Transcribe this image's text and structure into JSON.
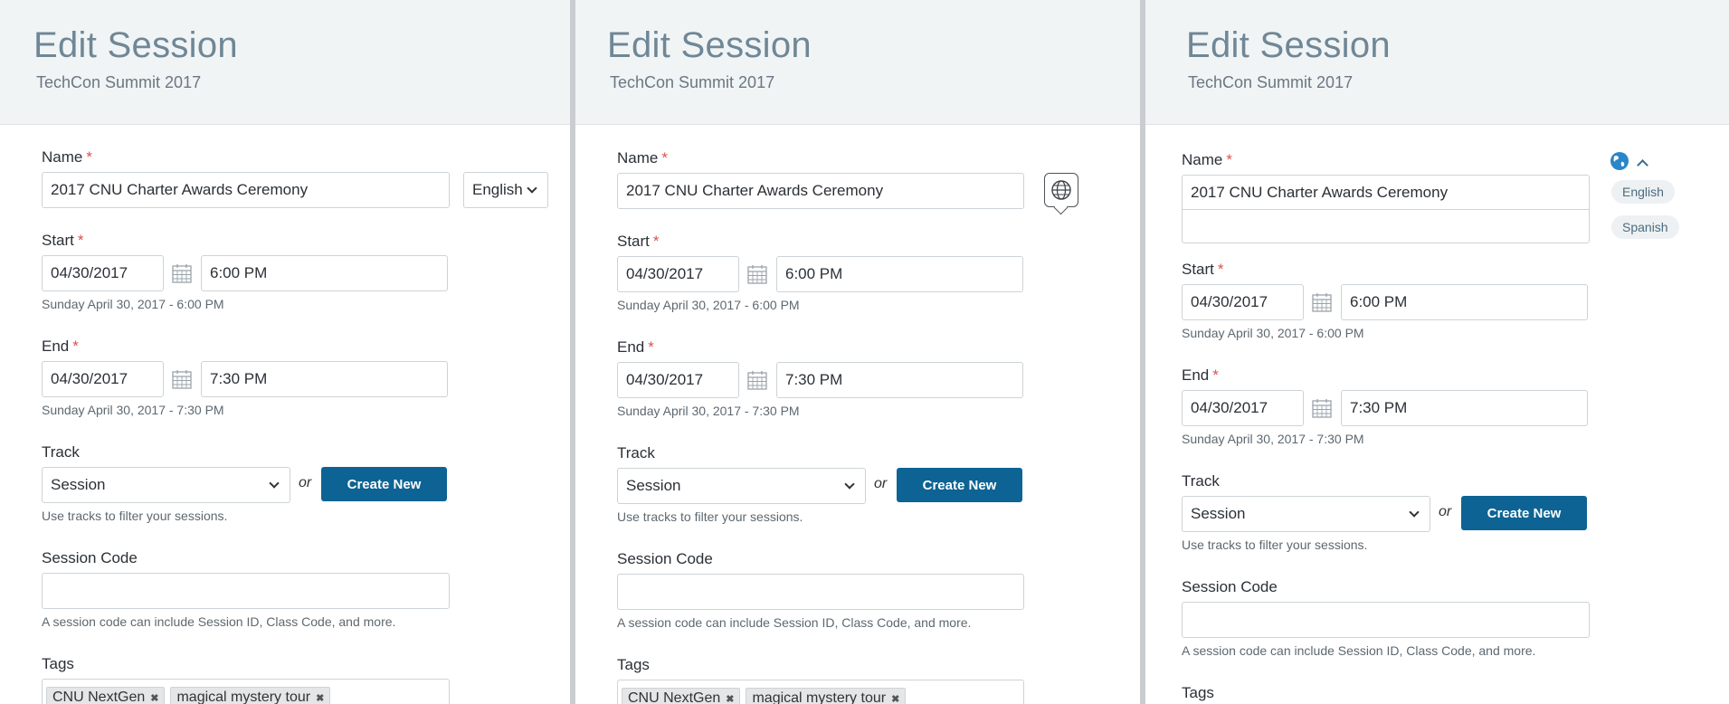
{
  "header": {
    "title": "Edit Session",
    "subtitle": "TechCon Summit 2017"
  },
  "form": {
    "name_label": "Name",
    "required_mark": "*",
    "name_value": "2017 CNU Charter Awards Ceremony",
    "start_label": "Start",
    "start_date": "04/30/2017",
    "start_time": "6:00 PM",
    "start_summary": "Sunday April 30, 2017 - 6:00 PM",
    "end_label": "End",
    "end_date": "04/30/2017",
    "end_time": "7:30 PM",
    "end_summary": "Sunday April 30, 2017 - 7:30 PM",
    "track_label": "Track",
    "track_value": "Session",
    "or_text": "or",
    "create_new_label": "Create New",
    "track_helper": "Use tracks to filter your sessions.",
    "session_code_label": "Session Code",
    "session_code_value": "",
    "session_code_helper": "A session code can include Session ID, Class Code, and more.",
    "tags_label": "Tags",
    "tags": [
      "CNU NextGen",
      "magical mystery tour"
    ],
    "tag_remove_glyph": "✖"
  },
  "language": {
    "selected": "English",
    "options": [
      "English",
      "Spanish"
    ]
  },
  "icons": {
    "calendar": "calendar-icon",
    "globe": "globe-icon",
    "chevron_down": "chevron-down-icon",
    "chevron_up": "chevron-up-icon"
  },
  "colors": {
    "primary_button": "#0d6393",
    "required": "#d9534f",
    "header_bg": "#f1f4f5",
    "title": "#6f8796"
  }
}
